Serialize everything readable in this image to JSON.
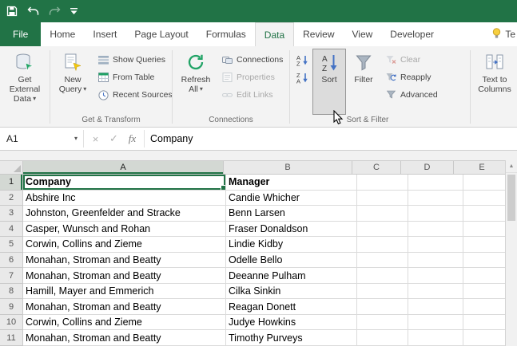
{
  "titlebar": {
    "quick_access": [
      "save",
      "undo",
      "redo",
      "customize-quick-access"
    ]
  },
  "tabs": {
    "file": "File",
    "items": [
      "Home",
      "Insert",
      "Page Layout",
      "Formulas",
      "Data",
      "Review",
      "View",
      "Developer"
    ],
    "active": "Data",
    "tell_me": "Te"
  },
  "ribbon": {
    "get_external_data": {
      "l1": "Get External",
      "l2": "Data"
    },
    "new_query": {
      "l1": "New",
      "l2": "Query"
    },
    "show_queries": "Show Queries",
    "from_table": "From Table",
    "recent_sources": "Recent Sources",
    "group_get_transform": "Get & Transform",
    "refresh_all": {
      "l1": "Refresh",
      "l2": "All"
    },
    "connections": "Connections",
    "properties": "Properties",
    "edit_links": "Edit Links",
    "group_connections": "Connections",
    "sort": "Sort",
    "filter": "Filter",
    "clear": "Clear",
    "reapply": "Reapply",
    "advanced": "Advanced",
    "group_sort_filter": "Sort & Filter",
    "text_to_columns": {
      "l1": "Text to",
      "l2": "Columns"
    }
  },
  "formula_bar": {
    "name_box": "A1",
    "fx_label": "fx",
    "content": "Company"
  },
  "grid": {
    "columns": [
      "A",
      "B",
      "C",
      "D",
      "E"
    ],
    "selected_cell": "A1",
    "selected_column": "A",
    "rows": [
      {
        "n": 1,
        "a": "Company",
        "b": "Manager",
        "bold": true
      },
      {
        "n": 2,
        "a": "Abshire Inc",
        "b": "Candie Whicher"
      },
      {
        "n": 3,
        "a": "Johnston, Greenfelder and Stracke",
        "b": "Benn Larsen"
      },
      {
        "n": 4,
        "a": "Casper, Wunsch and Rohan",
        "b": "Fraser Donaldson"
      },
      {
        "n": 5,
        "a": "Corwin, Collins and Zieme",
        "b": "Lindie Kidby"
      },
      {
        "n": 6,
        "a": "Monahan, Stroman and Beatty",
        "b": "Odelle Bello"
      },
      {
        "n": 7,
        "a": "Monahan, Stroman and Beatty",
        "b": "Deeanne Pulham"
      },
      {
        "n": 8,
        "a": "Hamill, Mayer and Emmerich",
        "b": "Cilka Sinkin"
      },
      {
        "n": 9,
        "a": "Monahan, Stroman and Beatty",
        "b": "Reagan Donett"
      },
      {
        "n": 10,
        "a": "Corwin, Collins and Zieme",
        "b": "Judye Howkins"
      },
      {
        "n": 11,
        "a": "Monahan, Stroman and Beatty",
        "b": "Timothy Purveys"
      }
    ]
  },
  "colors": {
    "excel_green": "#217346",
    "ribbon_bg": "#f3f3f3",
    "grid_line": "#dbdbdb",
    "selection_header_fill": "#d3d8d3"
  }
}
